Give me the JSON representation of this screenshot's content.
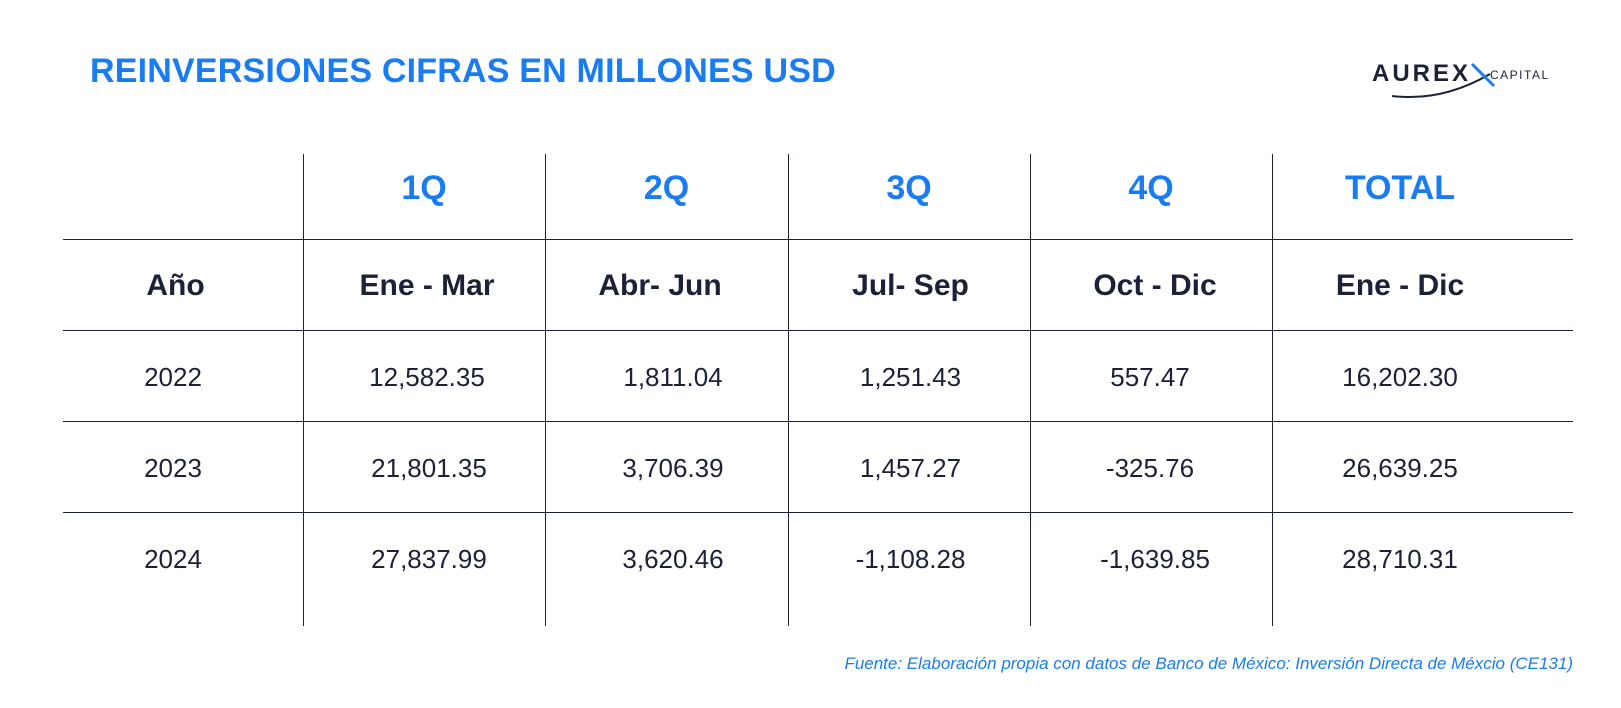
{
  "title": "REINVERSIONES CIFRAS EN MILLONES USD",
  "logo": {
    "brand": "AUREX",
    "sub": "CAPITAL"
  },
  "table": {
    "quarters": [
      "",
      "1Q",
      "2Q",
      "3Q",
      "4Q",
      "TOTAL"
    ],
    "periods": [
      "Año",
      "Ene - Mar",
      "Abr- Jun",
      "Jul- Sep",
      "Oct - Dic",
      "Ene - Dic"
    ],
    "rows": [
      [
        "2022",
        "12,582.35",
        "1,811.04",
        "1,251.43",
        "557.47",
        "16,202.30"
      ],
      [
        "2023",
        "21,801.35",
        "3,706.39",
        "1,457.27",
        "-325.76",
        "26,639.25"
      ],
      [
        "2024",
        "27,837.99",
        "3,620.46",
        "-1,108.28",
        "-1,639.85",
        "28,710.31"
      ]
    ]
  },
  "source": "Fuente: Elaboración propia con datos de Banco de México: Inversión Directa de Méxcio (CE131)",
  "colors": {
    "accent": "#1a7cf2",
    "text": "#1c2138"
  }
}
